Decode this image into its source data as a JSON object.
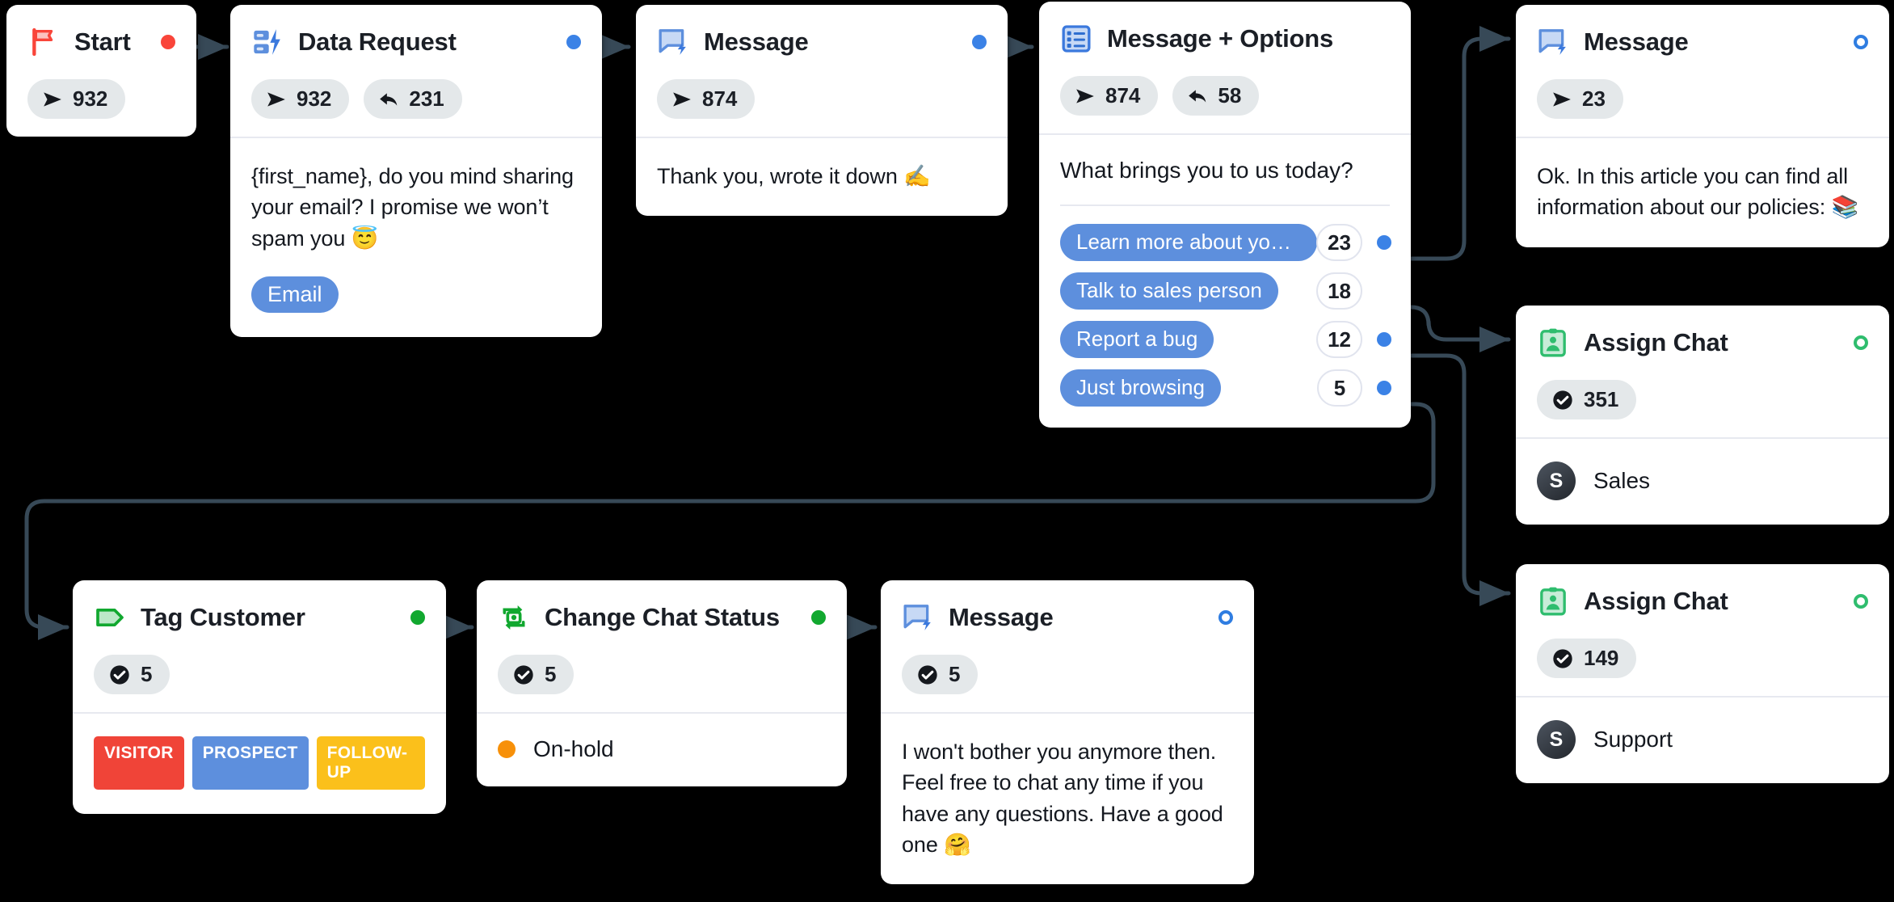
{
  "canvas": {
    "background": "#000000",
    "edge_color": "#374957"
  },
  "palette": {
    "blue": "#5d8fdd",
    "port_blue": "#3b82e6",
    "red": "#f9453a",
    "green": "#11a82f",
    "green_light": "#2fbd6e",
    "chip_bg": "#e4e8ea",
    "tag_visitor": "#f04438",
    "tag_prospect": "#5d8fdd",
    "tag_followup": "#fbc01b",
    "status_onhold": "#f79009"
  },
  "nodes": {
    "start": {
      "title": "Start",
      "icon": "flag-icon",
      "port": "filled-red",
      "stats": [
        {
          "icon": "send-icon",
          "value": "932"
        }
      ]
    },
    "data_request": {
      "title": "Data Request",
      "icon": "data-request-icon",
      "port": "filled-blue",
      "stats": [
        {
          "icon": "send-icon",
          "value": "932"
        },
        {
          "icon": "reply-icon",
          "value": "231"
        }
      ],
      "body_text": "{first_name}, do you mind sharing your email? I promise we won’t spam you 😇",
      "chip": "Email"
    },
    "message_thanks": {
      "title": "Message",
      "icon": "message-icon",
      "port": "filled-blue",
      "stats": [
        {
          "icon": "send-icon",
          "value": "874"
        }
      ],
      "body_text": "Thank you, wrote it down ✍️"
    },
    "message_options": {
      "title": "Message + Options",
      "icon": "options-icon",
      "stats": [
        {
          "icon": "send-icon",
          "value": "874"
        },
        {
          "icon": "reply-icon",
          "value": "58"
        }
      ],
      "question": "What brings you to us today?",
      "options": [
        {
          "label": "Learn more about your…",
          "count": "23",
          "has_port": true
        },
        {
          "label": "Talk to sales person",
          "count": "18",
          "has_port": false
        },
        {
          "label": "Report a bug",
          "count": "12",
          "has_port": true
        },
        {
          "label": "Just browsing",
          "count": "5",
          "has_port": true
        }
      ]
    },
    "message_policies": {
      "title": "Message",
      "icon": "message-icon",
      "port": "hollow-blue",
      "stats": [
        {
          "icon": "send-icon",
          "value": "23"
        }
      ],
      "body_text": "Ok. In this article you can find all information about our policies: 📚"
    },
    "assign_sales": {
      "title": "Assign Chat",
      "icon": "assign-chat-icon",
      "port": "hollow-green",
      "stats": [
        {
          "icon": "check-icon",
          "value": "351"
        }
      ],
      "agent_initial": "S",
      "agent_name": "Sales"
    },
    "assign_support": {
      "title": "Assign Chat",
      "icon": "assign-chat-icon",
      "port": "hollow-green",
      "stats": [
        {
          "icon": "check-icon",
          "value": "149"
        }
      ],
      "agent_initial": "S",
      "agent_name": "Support"
    },
    "tag_customer": {
      "title": "Tag Customer",
      "icon": "tag-icon",
      "port": "filled-green",
      "stats": [
        {
          "icon": "check-icon",
          "value": "5"
        }
      ],
      "tags": [
        {
          "label": "VISITOR",
          "color": "#f04438"
        },
        {
          "label": "PROSPECT",
          "color": "#5d8fdd"
        },
        {
          "label": "FOLLOW-UP",
          "color": "#fbc01b"
        }
      ]
    },
    "change_status": {
      "title": "Change Chat Status",
      "icon": "change-status-icon",
      "port": "filled-green",
      "stats": [
        {
          "icon": "check-icon",
          "value": "5"
        }
      ],
      "status_label": "On-hold",
      "status_color": "#f79009"
    },
    "message_goodbye": {
      "title": "Message",
      "icon": "message-icon",
      "port": "hollow-blue",
      "stats": [
        {
          "icon": "check-icon",
          "value": "5"
        }
      ],
      "body_text": "I won't bother you anymore then. Feel free to chat any time if you have any questions. Have a good one 🤗"
    }
  }
}
